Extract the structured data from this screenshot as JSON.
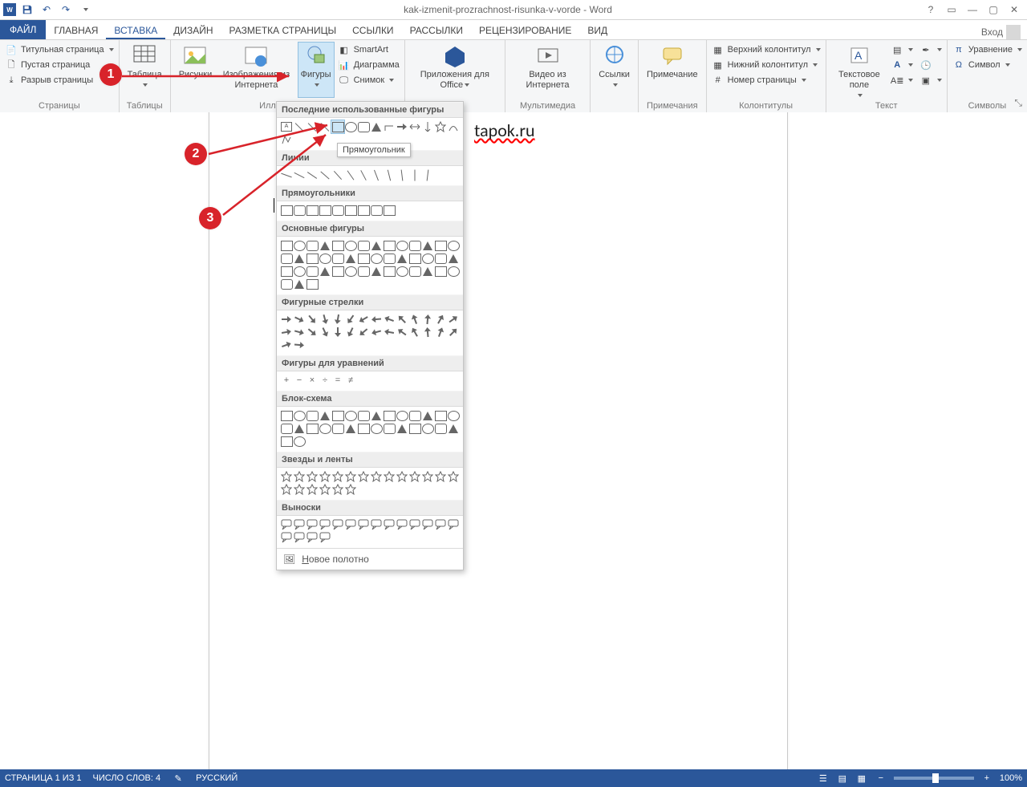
{
  "title": "kak-izmenit-prozrachnost-risunka-v-vorde - Word",
  "login": "Вход",
  "tabs": {
    "file": "ФАЙЛ",
    "home": "ГЛАВНАЯ",
    "insert": "ВСТАВКА",
    "design": "ДИЗАЙН",
    "page_layout": "РАЗМЕТКА СТРАНИЦЫ",
    "references": "ССЫЛКИ",
    "mailings": "РАССЫЛКИ",
    "review": "РЕЦЕНЗИРОВАНИЕ",
    "view": "ВИД"
  },
  "ribbon": {
    "pages": {
      "label": "Страницы",
      "cover_page": "Титульная страница",
      "blank_page": "Пустая страница",
      "page_break": "Разрыв страницы"
    },
    "tables": {
      "label": "Таблицы",
      "table": "Таблица"
    },
    "illustrations": {
      "label": "Иллюстрации",
      "pictures": "Рисунки",
      "online_pictures": "Изображения из Интернета",
      "shapes": "Фигуры",
      "smartart": "SmartArt",
      "chart": "Диаграмма",
      "screenshot": "Снимок"
    },
    "apps": {
      "label": "Приложения",
      "store": "Приложения для Office"
    },
    "media": {
      "label": "Мультимедиа",
      "online_video": "Видео из Интернета"
    },
    "links": {
      "label": "Ссылки",
      "links_btn": "Ссылки"
    },
    "comments": {
      "label": "Примечания",
      "comment": "Примечание"
    },
    "header_footer": {
      "label": "Колонтитулы",
      "header": "Верхний колонтитул",
      "footer": "Нижний колонтитул",
      "page_number": "Номер страницы"
    },
    "text": {
      "label": "Текст",
      "text_box": "Текстовое поле"
    },
    "symbols": {
      "label": "Символы",
      "equation": "Уравнение",
      "symbol": "Символ"
    }
  },
  "shapes_panel": {
    "recent": "Последние использованные фигуры",
    "lines": "Линии",
    "rectangles": "Прямоугольники",
    "basic": "Основные фигуры",
    "block_arrows": "Фигурные стрелки",
    "equation": "Фигуры для уравнений",
    "flowchart": "Блок-схема",
    "stars": "Звезды и ленты",
    "callouts": "Выноски",
    "new_canvas": "Новое полотно",
    "tooltip": "Прямоугольник"
  },
  "document": {
    "watermark_visible": "tapok.ru"
  },
  "annotations": {
    "one": "1",
    "two": "2",
    "three": "3"
  },
  "statusbar": {
    "page": "СТРАНИЦА 1 ИЗ 1",
    "words": "ЧИСЛО СЛОВ: 4",
    "lang": "РУССКИЙ",
    "zoom": "100%"
  }
}
